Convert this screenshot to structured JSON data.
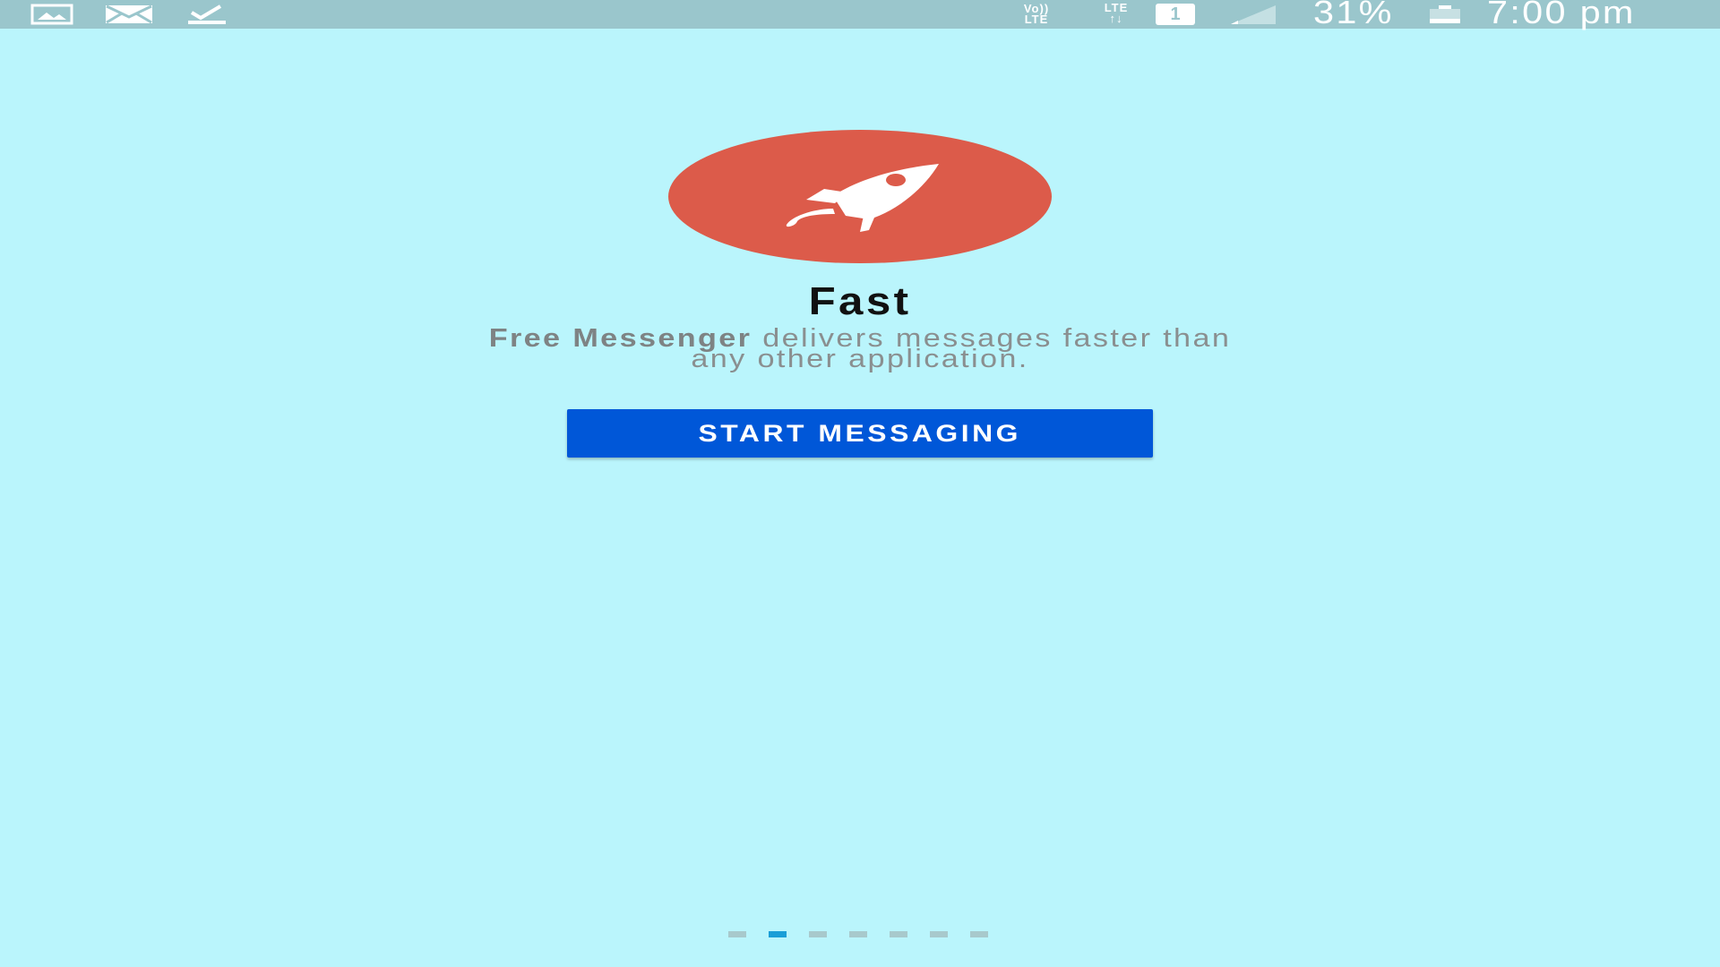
{
  "status_bar": {
    "icons_left": [
      "gallery-icon",
      "mail-icon",
      "download-done-icon"
    ],
    "volte_line1": "Vo))",
    "volte_line2": "LTE",
    "lte_line1": "LTE",
    "lte_line2": "↑↓",
    "sim_slot": "1",
    "signal_icon": "signal-icon",
    "battery_percent_text": "31%",
    "battery_level": 0.31,
    "time": "7:00 pm"
  },
  "hero": {
    "icon": "rocket-icon",
    "circle_color": "#dc5b4a",
    "title": "Fast",
    "description_brand": "Free Messenger",
    "description_line1_rest": " delivers messages faster than",
    "description_line2": "any other application."
  },
  "actions": {
    "start_label": "START MESSAGING",
    "button_color": "#0057d8"
  },
  "pager": {
    "page_count": 7,
    "current_page": 2,
    "active_color": "#1a9ed7",
    "inactive_color": "#a8c9cc"
  },
  "colors": {
    "background": "#baf5fc",
    "status_bar": "#9ac6cc"
  }
}
